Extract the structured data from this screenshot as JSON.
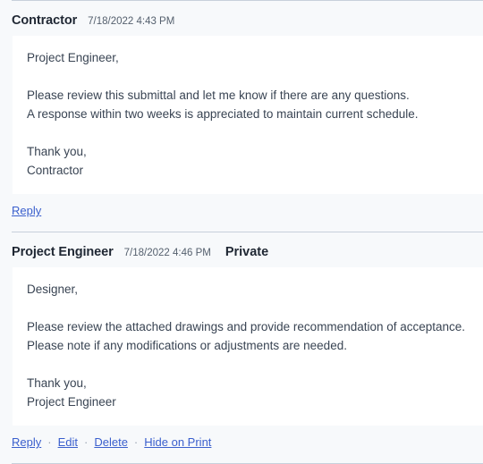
{
  "thread": {
    "comments": [
      {
        "author": "Contractor",
        "timestamp": "7/18/2022 4:43 PM",
        "privacy": "",
        "body_lines": [
          "Project Engineer,",
          "",
          "Please review this submittal and let me know if there are any questions.",
          "A response within two weeks is appreciated to maintain current schedule.",
          "",
          "Thank you,",
          "Contractor"
        ],
        "actions": [
          "Reply"
        ],
        "separator": "·"
      },
      {
        "author": "Project Engineer",
        "timestamp": "7/18/2022 4:46 PM",
        "privacy": "Private",
        "body_lines": [
          "Designer,",
          "",
          "Please review the attached drawings and provide recommendation of acceptance.",
          "Please note if any modifications or adjustments are needed.",
          "",
          "Thank you,",
          "Project Engineer"
        ],
        "actions": [
          "Reply",
          "Edit",
          "Delete",
          "Hide on Print"
        ],
        "separator": "·"
      }
    ]
  },
  "colors": {
    "page_background": "#f7f9fb",
    "card_background": "#ffffff",
    "divider": "#c8d0db",
    "link": "#3a5fcd",
    "author_text": "#1f2733",
    "body_text": "#394453",
    "timestamp_text": "#55606e"
  }
}
